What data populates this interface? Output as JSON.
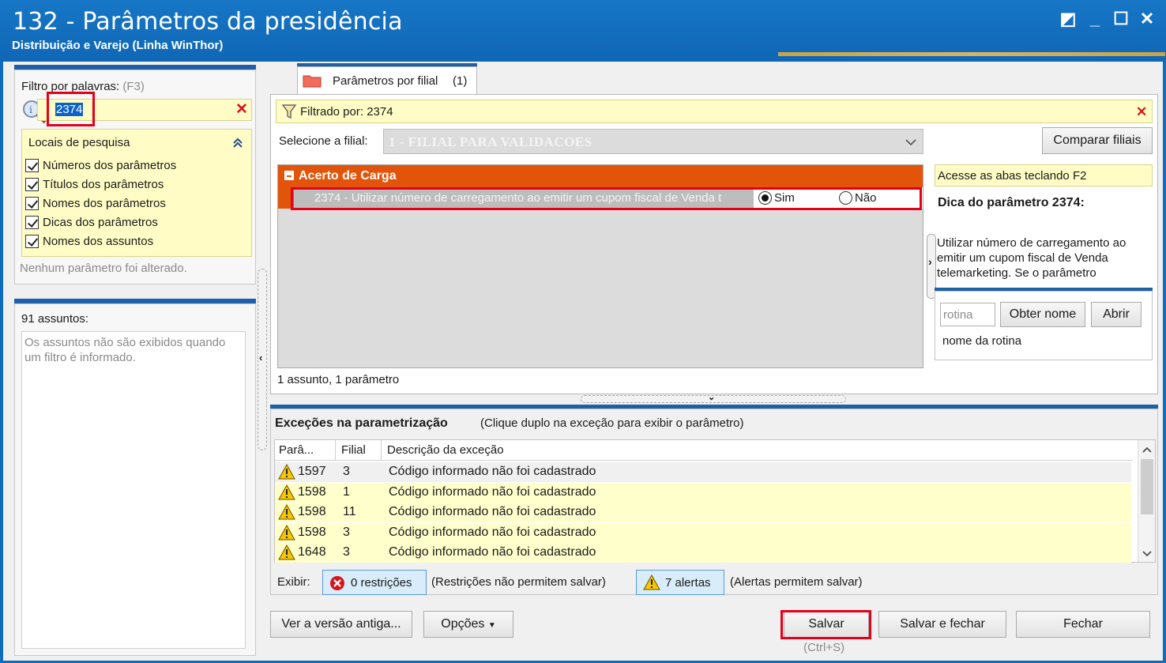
{
  "window": {
    "title": "132 - Parâmetros da presidência",
    "subtitle": "Distribuição e Varejo (Linha WinThor)",
    "controls": [
      "◩",
      "_",
      "☐",
      "✕"
    ]
  },
  "left": {
    "filter_label": "Filtro por palavras:",
    "filter_shortcut": "(F3)",
    "filter_value": "2374",
    "search_places_title": "Locais de pesquisa",
    "search_places": [
      "Números dos parâmetros",
      "Títulos dos parâmetros",
      "Nomes dos parâmetros",
      "Dicas dos parâmetros",
      "Nomes dos assuntos"
    ],
    "no_change": "Nenhum parâmetro foi alterado.",
    "subjects_count": "91 assuntos:",
    "subjects_note": "Os assuntos não são exibidos quando um filtro é informado."
  },
  "tab": {
    "label": "Parâmetros por filial",
    "count": "(1)"
  },
  "filter_bar": {
    "text": "Filtrado por: 2374"
  },
  "branch": {
    "label": "Selecione a filial:",
    "value": "1 - FILIAL PARA VALIDACOES",
    "compare_button": "Comparar filiais"
  },
  "params": {
    "group_title": "Acerto de Carga",
    "row_text": "2374 - Utilizar número de carregamento ao emitir um cupom fiscal de Venda t",
    "option_yes": "Sim",
    "option_no": "Não",
    "selected": "Sim",
    "summary": "1 assunto, 1 parâmetro"
  },
  "tip": {
    "hint": "Acesse as abas teclando F2",
    "title": "Dica do parâmetro 2374:",
    "text": "Utilizar número de carregamento ao emitir um cupom fiscal de Venda telemarketing. Se o parâmetro",
    "routine_placeholder": "rotina",
    "get_name_button": "Obter nome",
    "open_button": "Abrir",
    "routine_name": "nome da rotina"
  },
  "exceptions": {
    "title": "Exceções na parametrização",
    "subtitle": "(Clique duplo na exceção para exibir o parâmetro)",
    "columns": [
      "Parâ...",
      "Filial",
      "Descrição da exceção"
    ],
    "rows": [
      {
        "param": "1597",
        "branch": "3",
        "desc": "Código informado não foi cadastrado"
      },
      {
        "param": "1598",
        "branch": "1",
        "desc": "Código informado não foi cadastrado"
      },
      {
        "param": "1598",
        "branch": "11",
        "desc": "Código informado não foi cadastrado"
      },
      {
        "param": "1598",
        "branch": "3",
        "desc": "Código informado não foi cadastrado"
      },
      {
        "param": "1648",
        "branch": "3",
        "desc": "Código informado não foi cadastrado"
      }
    ],
    "show_label": "Exibir:",
    "restrictions_button": "0 restrições",
    "restrictions_note": "(Restrições não permitem salvar)",
    "alerts_button": "7 alertas",
    "alerts_note": "(Alertas permitem salvar)"
  },
  "footer": {
    "old_version_button": "Ver a versão antiga...",
    "options_button": "Opções",
    "save_button": "Salvar",
    "save_shortcut": "(Ctrl+S)",
    "save_close_button": "Salvar e fechar",
    "close_button": "Fechar"
  },
  "colors": {
    "title_blue": "#0f67b6",
    "panel_accent": "#1f5fa8",
    "group_orange": "#e2540a",
    "highlight_yellow": "#fffdc5",
    "annotation_red": "#e3001b"
  }
}
